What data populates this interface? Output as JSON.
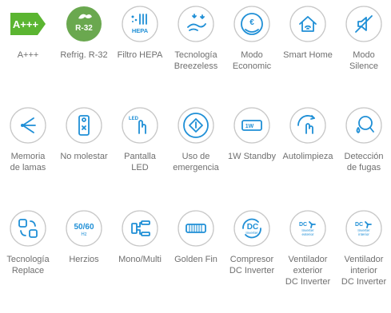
{
  "rows": [
    [
      {
        "label": "A+++",
        "badge": "A+++",
        "color": "#5bb531"
      },
      {
        "label": "Refrig. R-32",
        "badge": "R-32",
        "color": "#6aa84f"
      },
      {
        "label": "Filtro HEPA",
        "badge": "HEPA",
        "color": "#1f8fd6"
      },
      {
        "label": "Tecnología\nBreezeless",
        "color": "#1f8fd6"
      },
      {
        "label": "Modo\nEconomic",
        "badge": "€",
        "color": "#1f8fd6"
      },
      {
        "label": "Smart Home",
        "color": "#1f8fd6"
      },
      {
        "label": "Modo\nSilence",
        "color": "#1f8fd6"
      }
    ],
    [
      {
        "label": "Memoria\nde lamas",
        "color": "#1f8fd6"
      },
      {
        "label": "No molestar",
        "color": "#1f8fd6"
      },
      {
        "label": "Pantalla\nLED",
        "badge": "LED",
        "color": "#1f8fd6"
      },
      {
        "label": "Uso de\nemergencia",
        "color": "#1f8fd6"
      },
      {
        "label": "1W Standby",
        "badge": "1W",
        "color": "#1f8fd6"
      },
      {
        "label": "Autolimpieza",
        "color": "#1f8fd6"
      },
      {
        "label": "Detección\nde fugas",
        "color": "#1f8fd6"
      }
    ],
    [
      {
        "label": "Tecnología\nReplace",
        "color": "#1f8fd6"
      },
      {
        "label": "Herzios",
        "badge": "50/60",
        "sub": "Hz",
        "color": "#1f8fd6"
      },
      {
        "label": "Mono/Multi",
        "color": "#1f8fd6"
      },
      {
        "label": "Golden Fin",
        "color": "#1f8fd6"
      },
      {
        "label": "Compresor\nDC Inverter",
        "badge": "DC",
        "sub": "Inverter",
        "color": "#1f8fd6"
      },
      {
        "label": "Ventilador\nexterior\nDC Inverter",
        "badge": "DC",
        "sub": "Inverter\nexterior",
        "color": "#1f8fd6"
      },
      {
        "label": "Ventilador\ninterior\nDC Inverter",
        "badge": "DC",
        "sub": "Inverter\ninterior",
        "color": "#1f8fd6"
      }
    ]
  ]
}
